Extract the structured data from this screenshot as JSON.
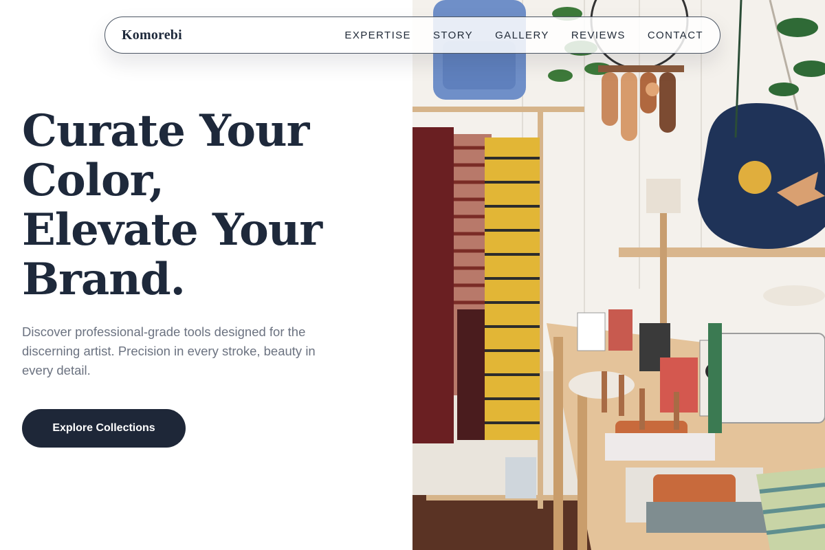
{
  "nav": {
    "brand": "Komorebi",
    "links": [
      "EXPERTISE",
      "STORY",
      "GALLERY",
      "REVIEWS",
      "CONTACT"
    ]
  },
  "hero": {
    "title_lines": [
      "Curate Your",
      "Color,",
      "Elevate Your",
      "Brand."
    ],
    "subtitle": "Discover professional-grade tools designed for the discerning artist. Precision in every stroke, beauty in every detail.",
    "cta_label": "Explore Collections"
  },
  "colors": {
    "primary_dark": "#1e2738",
    "heading": "#1e293b",
    "muted_text": "#6b7280",
    "background": "#ffffff"
  },
  "icons": []
}
